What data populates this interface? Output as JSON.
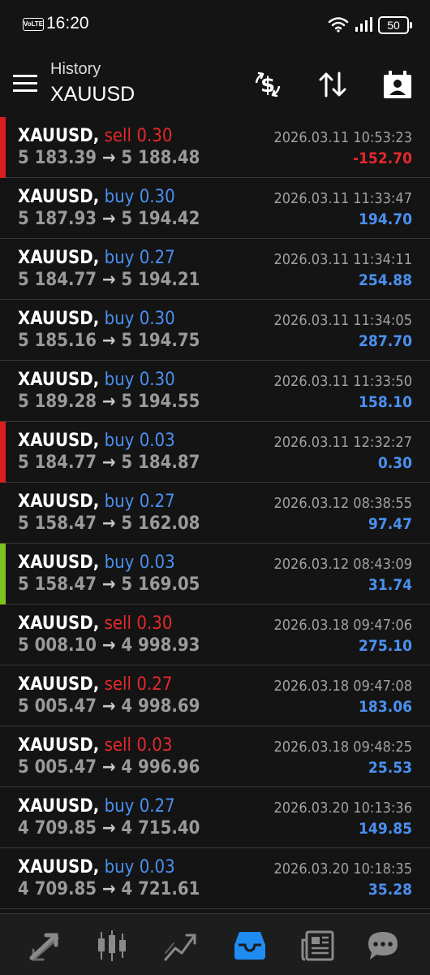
{
  "status": {
    "network_badge": "VoLTE",
    "time": "16:20",
    "battery": "50"
  },
  "toolbar": {
    "label": "History",
    "title": "XAUUSD"
  },
  "colors": {
    "sell": "#e5282c",
    "buy": "#4a90f0",
    "profit_positive": "#4a90f0",
    "profit_negative": "#e5282c",
    "marker_red": "#d81e1e",
    "marker_green": "#7cc21f",
    "nav_active": "#1e8cf0"
  },
  "trades": [
    {
      "symbol": "XAUUSD,",
      "type": "sell",
      "volume": "0.30",
      "open": "5 183.39",
      "arrow": "→",
      "close": "5 188.48",
      "time": "2026.03.11 10:53:23",
      "profit": "-152.70",
      "marker": "red"
    },
    {
      "symbol": "XAUUSD,",
      "type": "buy",
      "volume": "0.30",
      "open": "5 187.93",
      "arrow": "→",
      "close": "5 194.42",
      "time": "2026.03.11 11:33:47",
      "profit": "194.70",
      "marker": ""
    },
    {
      "symbol": "XAUUSD,",
      "type": "buy",
      "volume": "0.27",
      "open": "5 184.77",
      "arrow": "→",
      "close": "5 194.21",
      "time": "2026.03.11 11:34:11",
      "profit": "254.88",
      "marker": ""
    },
    {
      "symbol": "XAUUSD,",
      "type": "buy",
      "volume": "0.30",
      "open": "5 185.16",
      "arrow": "→",
      "close": "5 194.75",
      "time": "2026.03.11 11:34:05",
      "profit": "287.70",
      "marker": ""
    },
    {
      "symbol": "XAUUSD,",
      "type": "buy",
      "volume": "0.30",
      "open": "5 189.28",
      "arrow": "→",
      "close": "5 194.55",
      "time": "2026.03.11 11:33:50",
      "profit": "158.10",
      "marker": ""
    },
    {
      "symbol": "XAUUSD,",
      "type": "buy",
      "volume": "0.03",
      "open": "5 184.77",
      "arrow": "→",
      "close": "5 184.87",
      "time": "2026.03.11 12:32:27",
      "profit": "0.30",
      "marker": "red"
    },
    {
      "symbol": "XAUUSD,",
      "type": "buy",
      "volume": "0.27",
      "open": "5 158.47",
      "arrow": "→",
      "close": "5 162.08",
      "time": "2026.03.12 08:38:55",
      "profit": "97.47",
      "marker": ""
    },
    {
      "symbol": "XAUUSD,",
      "type": "buy",
      "volume": "0.03",
      "open": "5 158.47",
      "arrow": "→",
      "close": "5 169.05",
      "time": "2026.03.12 08:43:09",
      "profit": "31.74",
      "marker": "green"
    },
    {
      "symbol": "XAUUSD,",
      "type": "sell",
      "volume": "0.30",
      "open": "5 008.10",
      "arrow": "→",
      "close": "4 998.93",
      "time": "2026.03.18 09:47:06",
      "profit": "275.10",
      "marker": ""
    },
    {
      "symbol": "XAUUSD,",
      "type": "sell",
      "volume": "0.27",
      "open": "5 005.47",
      "arrow": "→",
      "close": "4 998.69",
      "time": "2026.03.18 09:47:08",
      "profit": "183.06",
      "marker": ""
    },
    {
      "symbol": "XAUUSD,",
      "type": "sell",
      "volume": "0.03",
      "open": "5 005.47",
      "arrow": "→",
      "close": "4 996.96",
      "time": "2026.03.18 09:48:25",
      "profit": "25.53",
      "marker": ""
    },
    {
      "symbol": "XAUUSD,",
      "type": "buy",
      "volume": "0.27",
      "open": "4 709.85",
      "arrow": "→",
      "close": "4 715.40",
      "time": "2026.03.20 10:13:36",
      "profit": "149.85",
      "marker": ""
    },
    {
      "symbol": "XAUUSD,",
      "type": "buy",
      "volume": "0.03",
      "open": "4 709.85",
      "arrow": "→",
      "close": "4 721.61",
      "time": "2026.03.20 10:18:35",
      "profit": "35.28",
      "marker": ""
    }
  ],
  "nav": [
    {
      "icon": "quotes-icon",
      "active": false
    },
    {
      "icon": "chart-icon",
      "active": false
    },
    {
      "icon": "trade-icon",
      "active": false
    },
    {
      "icon": "history-icon",
      "active": true
    },
    {
      "icon": "news-icon",
      "active": false
    },
    {
      "icon": "messages-icon",
      "active": false
    }
  ]
}
